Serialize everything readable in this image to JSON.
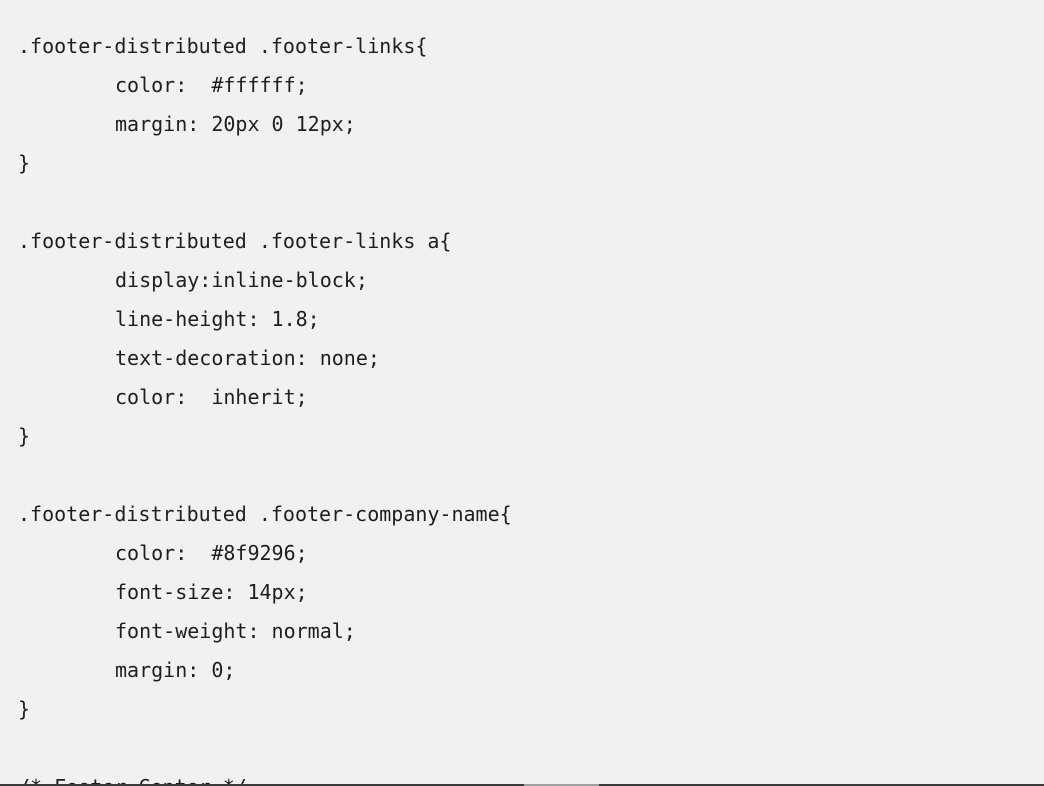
{
  "code": {
    "lines": [
      ".footer-distributed .footer-links{",
      "color:  #ffffff;",
      "margin: 20px 0 12px;",
      "}",
      "",
      ".footer-distributed .footer-links a{",
      "display:inline-block;",
      "line-height: 1.8;",
      "text-decoration: none;",
      "color:  inherit;",
      "}",
      "",
      ".footer-distributed .footer-company-name{",
      "color:  #8f9296;",
      "font-size: 14px;",
      "font-weight: normal;",
      "margin: 0;",
      "}",
      "",
      "/* Footer Center */"
    ]
  },
  "colors": {
    "panel_background": "#f1f1f1",
    "code_text": "#1e1e1e"
  }
}
